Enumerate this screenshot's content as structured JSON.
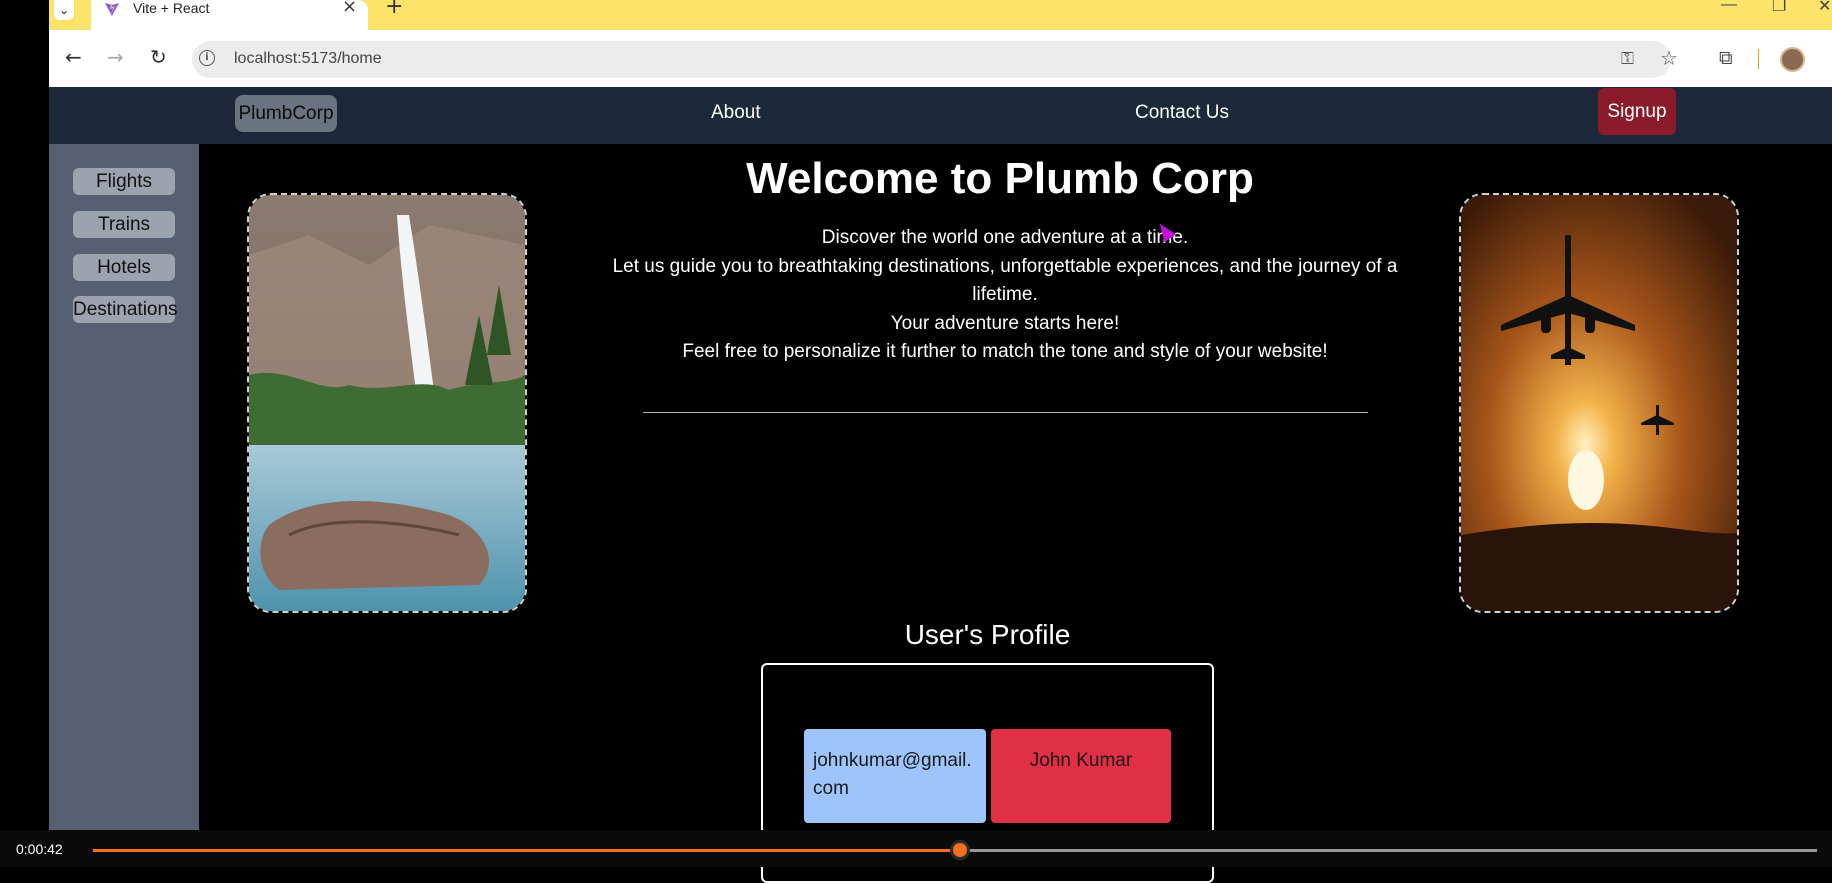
{
  "browser": {
    "tab_title": "Vite + React",
    "url": "localhost:5173/home",
    "window_controls": {
      "minimize": "—",
      "restore": "❐",
      "close": "✕"
    }
  },
  "navbar": {
    "brand": "PlumbCorp",
    "links": [
      "About",
      "Contact Us"
    ],
    "signup": "Signup"
  },
  "sidebar": {
    "items": [
      "Flights",
      "Trains",
      "Hotels",
      "Destinations"
    ]
  },
  "main": {
    "heading": "Welcome to Plumb Corp",
    "description": [
      "Discover the world one adventure at a time.",
      "Let us guide you to breathtaking destinations, unforgettable experiences, and the journey of a lifetime.",
      "Your adventure starts here!",
      "Feel free to personalize it further to match the tone and style of your website!"
    ],
    "profile_title": "User's Profile",
    "profile": {
      "email": "johnkumar@gmail.com",
      "name": "John Kumar"
    }
  },
  "video": {
    "time": "0:00:42",
    "progress": 0.503
  },
  "colors": {
    "tabstrip": "#fce36a",
    "navbar": "#1d283a",
    "sidebar": "#566072",
    "signup": "#8b1a2a",
    "email_box": "#9ec5fb",
    "name_box": "#e12f45",
    "video_accent": "#f26f22"
  }
}
